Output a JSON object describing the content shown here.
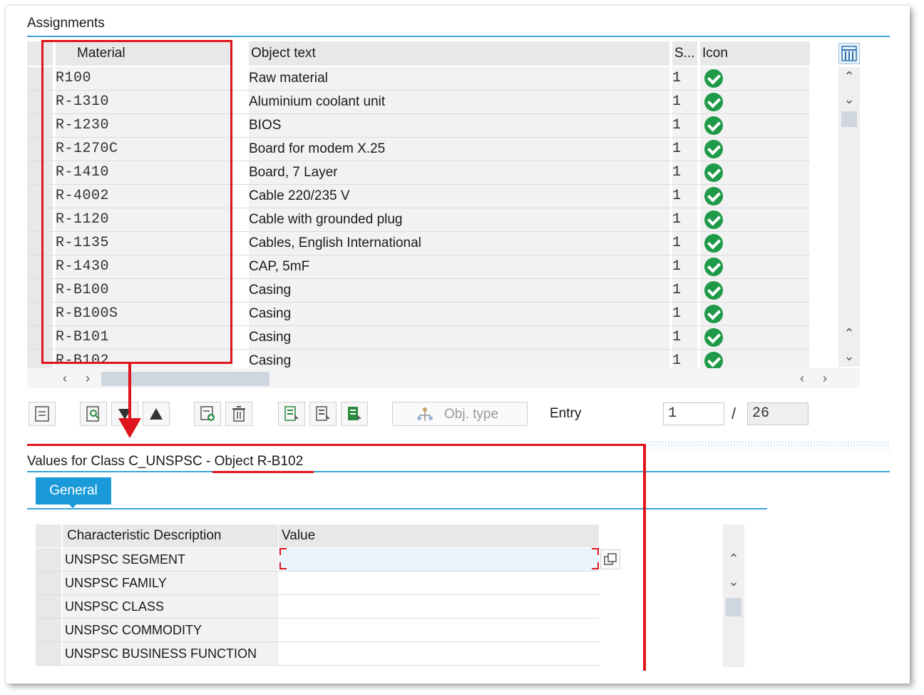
{
  "assignments": {
    "title": "Assignments",
    "columns": {
      "material": "Material",
      "object_text": "Object text",
      "status": "S...",
      "icon": "Icon"
    },
    "rows": [
      {
        "material": "R100",
        "text": "Raw material",
        "status": "1"
      },
      {
        "material": "R-1310",
        "text": "Aluminium coolant unit",
        "status": "1"
      },
      {
        "material": "R-1230",
        "text": "BIOS",
        "status": "1"
      },
      {
        "material": "R-1270C",
        "text": "Board for modem X.25",
        "status": "1"
      },
      {
        "material": "R-1410",
        "text": "Board, 7 Layer",
        "status": "1"
      },
      {
        "material": "R-4002",
        "text": "Cable 220/235 V",
        "status": "1"
      },
      {
        "material": "R-1120",
        "text": "Cable with grounded plug",
        "status": "1"
      },
      {
        "material": "R-1135",
        "text": "Cables, English International",
        "status": "1"
      },
      {
        "material": "R-1430",
        "text": "CAP, 5mF",
        "status": "1"
      },
      {
        "material": "R-B100",
        "text": "Casing",
        "status": "1"
      },
      {
        "material": "R-B100S",
        "text": "Casing",
        "status": "1"
      },
      {
        "material": "R-B101",
        "text": "Casing",
        "status": "1"
      },
      {
        "material": "R-B102",
        "text": "Casing",
        "status": "1"
      }
    ],
    "status_icon": "green-check-icon"
  },
  "toolbar": {
    "obj_type_label": "Obj. type",
    "entry_label": "Entry",
    "entry_value": "1",
    "separator": "/",
    "entry_total": "26"
  },
  "values": {
    "title_prefix": "Values for Class C_UNSPSC - ",
    "title_object": "Object R-B102",
    "tab_general": "General",
    "columns": {
      "description": "Characteristic Description",
      "value": "Value"
    },
    "rows": [
      {
        "description": "UNSPSC SEGMENT",
        "value": ""
      },
      {
        "description": "UNSPSC FAMILY",
        "value": ""
      },
      {
        "description": "UNSPSC CLASS",
        "value": ""
      },
      {
        "description": "UNSPSC COMMODITY",
        "value": ""
      },
      {
        "description": "UNSPSC BUSINESS FUNCTION",
        "value": ""
      }
    ]
  },
  "colors": {
    "accent": "#1a9ad9",
    "annotation": "#e0141c",
    "check": "#1f9a48"
  }
}
